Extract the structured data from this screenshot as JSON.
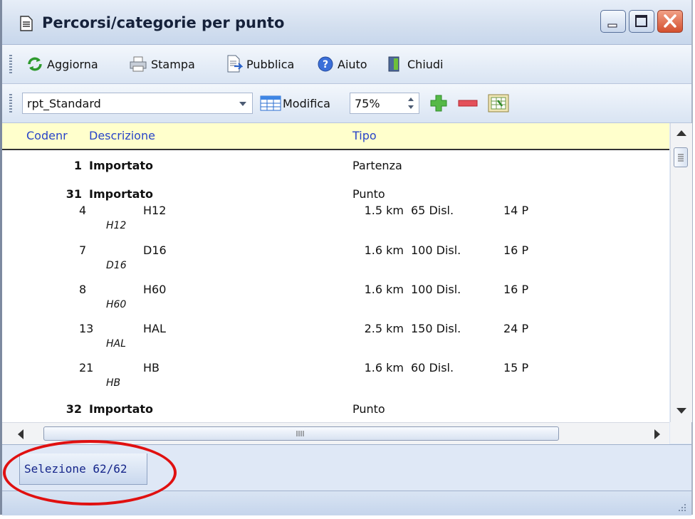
{
  "window": {
    "title": "Percorsi/categorie per punto"
  },
  "toolbar1": {
    "refresh_label": "Aggiorna",
    "print_label": "Stampa",
    "publish_label": "Pubblica",
    "help_label": "Aiuto",
    "close_label": "Chiudi"
  },
  "toolbar2": {
    "report_select_value": "rpt_Standard",
    "edit_label": "Modifica",
    "zoom_value": "75%"
  },
  "report": {
    "headers": {
      "code": "Codenr",
      "description": "Descrizione",
      "type": "Tipo"
    },
    "groups": [
      {
        "code": "1",
        "description": "Importato",
        "type": "Partenza"
      },
      {
        "code": "31",
        "description": "Importato",
        "type": "Punto"
      },
      {
        "code": "32",
        "description": "Importato",
        "type": "Punto"
      }
    ],
    "courses": [
      {
        "num": "4",
        "code": "H12",
        "name": "H12",
        "length": "1.5 km",
        "climb": "65 Disl.",
        "controls": "14 P"
      },
      {
        "num": "7",
        "code": "D16",
        "name": "D16",
        "length": "1.6 km",
        "climb": "100 Disl.",
        "controls": "16 P"
      },
      {
        "num": "8",
        "code": "H60",
        "name": "H60",
        "length": "1.6 km",
        "climb": "100 Disl.",
        "controls": "16 P"
      },
      {
        "num": "13",
        "code": "HAL",
        "name": "HAL",
        "length": "2.5 km",
        "climb": "150 Disl.",
        "controls": "24 P"
      },
      {
        "num": "21",
        "code": "HB",
        "name": "HB",
        "length": "1.6 km",
        "climb": "60 Disl.",
        "controls": "15 P"
      }
    ]
  },
  "bottom": {
    "selection_tab": "Selezione 62/62"
  }
}
